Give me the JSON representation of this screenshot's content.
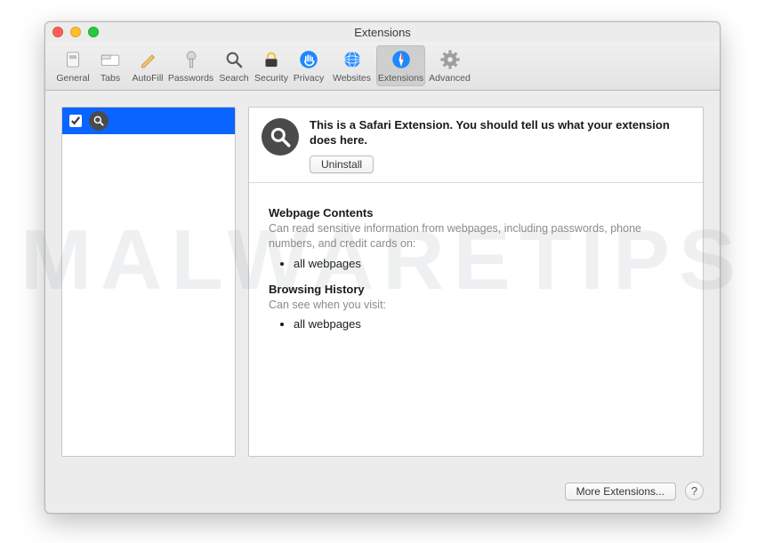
{
  "watermark": "MALWARETIPS",
  "window": {
    "title": "Extensions"
  },
  "toolbar": {
    "items": [
      {
        "label": "General"
      },
      {
        "label": "Tabs"
      },
      {
        "label": "AutoFill"
      },
      {
        "label": "Passwords"
      },
      {
        "label": "Search"
      },
      {
        "label": "Security"
      },
      {
        "label": "Privacy"
      },
      {
        "label": "Websites"
      },
      {
        "label": "Extensions"
      },
      {
        "label": "Advanced"
      }
    ],
    "selected_index": 8
  },
  "sidebar": {
    "items": [
      {
        "checked": true,
        "icon": "search-icon"
      }
    ]
  },
  "detail": {
    "description": "This is a Safari Extension. You should tell us what your extension does here.",
    "uninstall_label": "Uninstall",
    "sections": [
      {
        "title": "Webpage Contents",
        "subtitle": "Can read sensitive information from webpages, including passwords, phone numbers, and credit cards on:",
        "bullets": [
          "all webpages"
        ]
      },
      {
        "title": "Browsing History",
        "subtitle": "Can see when you visit:",
        "bullets": [
          "all webpages"
        ]
      }
    ]
  },
  "footer": {
    "more_label": "More Extensions...",
    "help_label": "?"
  }
}
